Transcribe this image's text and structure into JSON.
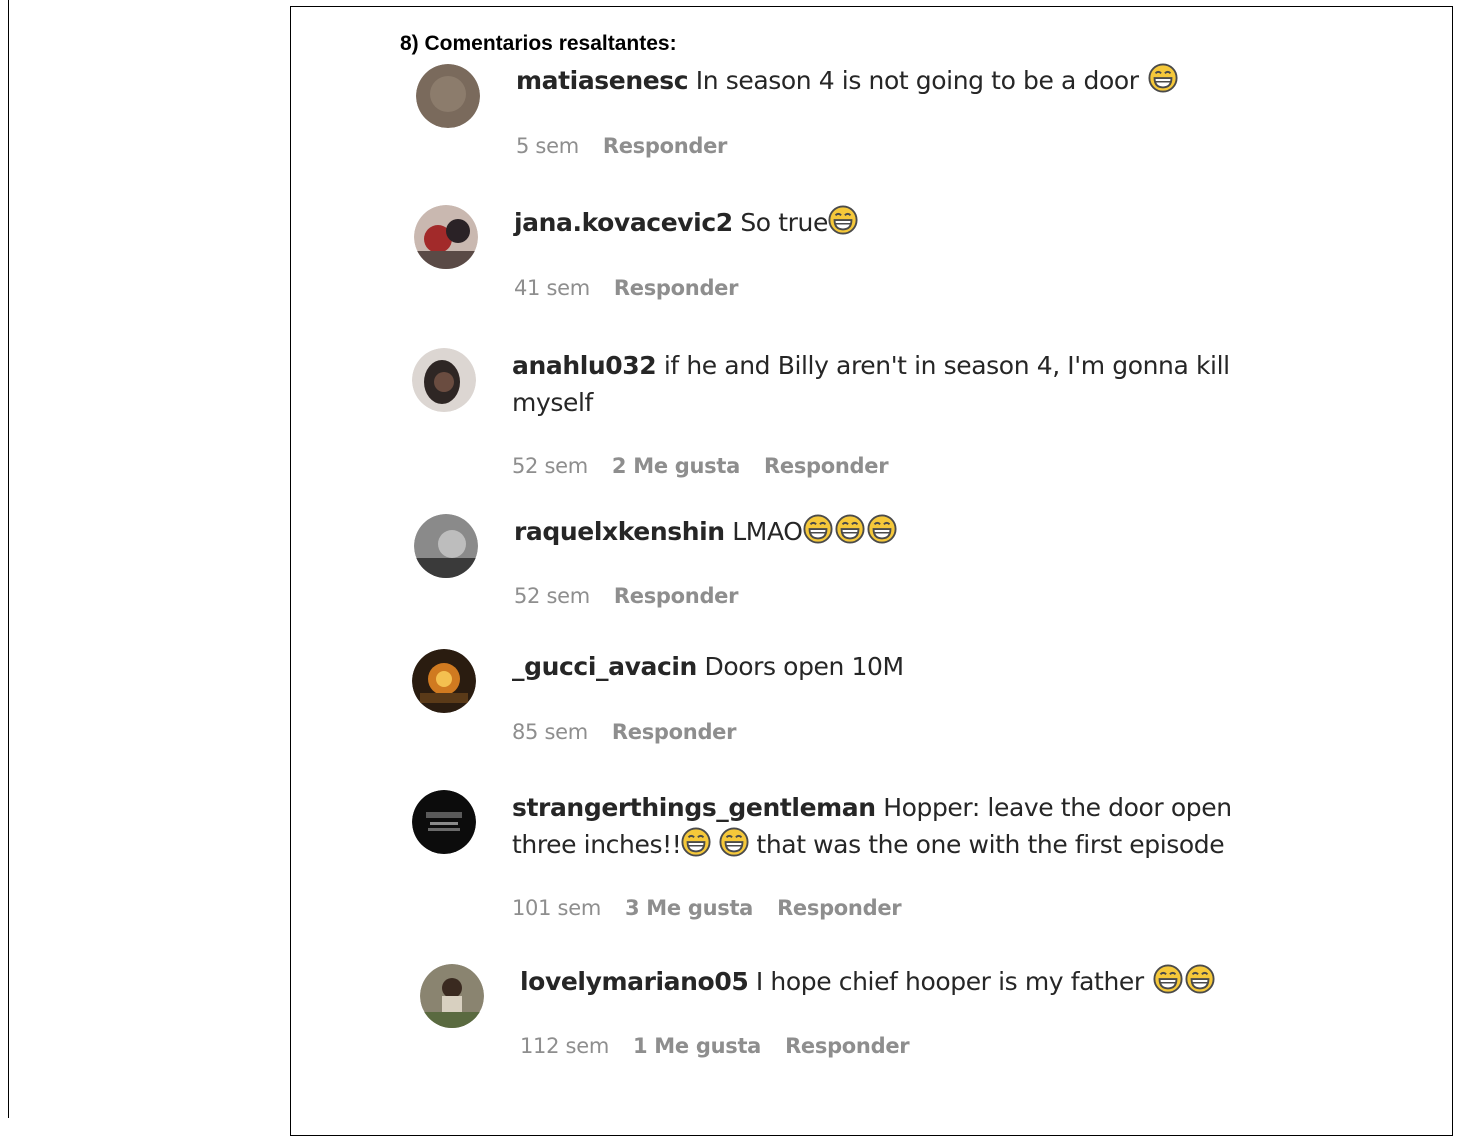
{
  "heading": "8) Comentarios resaltantes:",
  "comments": [
    {
      "username": "matiasenesc",
      "text": "In season 4 is not going to be a door",
      "emojis": 1,
      "time": "5 sem",
      "likes": "",
      "reply": "Responder",
      "avatar_color": "#7a6a5c"
    },
    {
      "username": "jana.kovacevic2",
      "text": "So true",
      "emojis": 1,
      "time": "41 sem",
      "likes": "",
      "reply": "Responder",
      "avatar_color": "#8a3a3a"
    },
    {
      "username": "anahlu032",
      "text": "if he and Billy aren't in season 4, I'm gonna kill myself",
      "emojis": 0,
      "time": "52 sem",
      "likes": "2 Me gusta",
      "reply": "Responder",
      "avatar_color": "#3a3330"
    },
    {
      "username": "raquelxkenshin",
      "text": "LMAO",
      "emojis": 3,
      "time": "52 sem",
      "likes": "",
      "reply": "Responder",
      "avatar_color": "#6b6b6b"
    },
    {
      "username": "_gucci_avacin",
      "text": "Doors open 10M",
      "emojis": 0,
      "time": "85 sem",
      "likes": "",
      "reply": "Responder",
      "avatar_color": "#6a3a10"
    },
    {
      "username": "strangerthings_gentleman",
      "text": "Hopper: leave the door open three inches!!",
      "text_after": "that was the one with the first episode",
      "emojis": 2,
      "time": "101 sem",
      "likes": "3 Me gusta",
      "reply": "Responder",
      "avatar_color": "#111111"
    },
    {
      "username": "lovelymariano05",
      "text": "I hope chief hooper is my father",
      "emojis": 2,
      "time": "112 sem",
      "likes": "1 Me gusta",
      "reply": "Responder",
      "avatar_color": "#6e6a5a"
    }
  ],
  "colors": {
    "text": "#262626",
    "meta": "#8e8e8e",
    "emoji_face": "#f5c83a"
  }
}
